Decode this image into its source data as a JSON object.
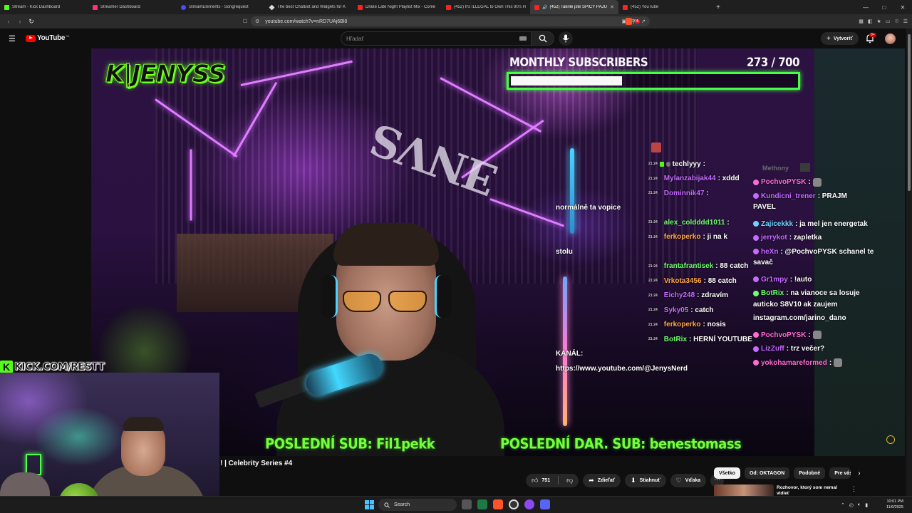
{
  "browser": {
    "tabs": [
      {
        "label": "Stream - Kick Dashboard",
        "color": "#53fc18"
      },
      {
        "label": "Streamer Dashboard",
        "color": "#ff2e7e"
      },
      {
        "label": "StreamElements - Songrequest",
        "color": "#4a4aff"
      },
      {
        "label": "The best ChatBot and Widgets for K",
        "color": "#dddddd"
      },
      {
        "label": "Drake Late Night Playlist Mix - Come",
        "color": "#ff2020"
      },
      {
        "label": "(452) It's ILLEGAL to Own This 90's H",
        "color": "#ff2020"
      },
      {
        "label": "(452) Takrile jste SPICY PÁJU",
        "color": "#ff2020",
        "active": true
      },
      {
        "label": "(452) YouTube",
        "color": "#ff2020"
      }
    ],
    "url": "youtube.com/watch?v=nRD7UAj6Bl8",
    "notif_count": "4"
  },
  "youtube": {
    "logo_text": "YouTube",
    "country_code": "SK",
    "search_placeholder": "Hľadať",
    "create_label": "Vytvoriť",
    "notification_badge": "9+"
  },
  "video": {
    "logo_overlay": "K|JENYSS",
    "subscribers_label": "MONTHLY SUBSCRIBERS",
    "subscribers_count": "273  / 700",
    "subscribers_current": 273,
    "subscribers_goal": 700,
    "last_sub": "POSLEDNÍ SUB: Fil1pekk",
    "last_gift_sub": "POSLEDNÍ DAR. SUB: benestomass",
    "kick_url": "KICK.COM/RESTT"
  },
  "stream_chat": [
    {
      "time": "21:24",
      "name": "techlyyy",
      "name_color": "#ffffff",
      "text": ":"
    },
    {
      "time": "21:24",
      "name": "Mylanzabijak44",
      "name_color": "#c56bff",
      "text": ": xddd"
    },
    {
      "time": "21:24",
      "name": "Dominnik47",
      "name_color": "#c56bff",
      "text": ": ",
      "cont": "normálně ta vopice"
    },
    {
      "time": "21:24",
      "name": "alex_coldddd1011",
      "name_color": "#6dff6d",
      "text": ": "
    },
    {
      "time": "21:24",
      "name": "ferkoperko",
      "name_color": "#ffa845",
      "text": ": ji na k",
      "cont": "stolu"
    },
    {
      "time": "21:24",
      "name": "frantafrantisek",
      "name_color": "#6dff6d",
      "text": ": 88 catch"
    },
    {
      "time": "21:24",
      "name": "Vrkota3456",
      "name_color": "#ffa845",
      "text": ": 88 catch"
    },
    {
      "time": "21:24",
      "name": "Eichy248",
      "name_color": "#c56bff",
      "text": ": zdravím"
    },
    {
      "time": "21:24",
      "name": "Syky05",
      "name_color": "#c56bff",
      "text": ": catch"
    },
    {
      "time": "21:24",
      "name": "ferkoperko",
      "name_color": "#ffa845",
      "text": ": nosis"
    },
    {
      "time": "21:24",
      "name": "BotRix",
      "name_color": "#6dff6d",
      "text": ": HERNÍ YOUTUBE",
      "cont": "KANÁL:",
      "cont2": "https://www.youtube.com/@JenysNerd"
    }
  ],
  "side_chat": {
    "ghost_name": "Methony",
    "messages": [
      {
        "name": "PochvoPYSK",
        "color": "#ff6bd5",
        "text": ":"
      },
      {
        "name": "Kundicni_trener",
        "color": "#c56bff",
        "text": ": PRAJM",
        "cont": "PAVEL"
      },
      {
        "name": "Zajicekkk",
        "color": "#6dd5ff",
        "text": ": ja mel jen energetak"
      },
      {
        "name": "jerrykot",
        "color": "#c56bff",
        "text": ": zapletka"
      },
      {
        "name": "heXn",
        "color": "#c56bff",
        "text": ": @PochvoPYSK schanel te",
        "cont": "savač"
      },
      {
        "name": "Gr1mpy",
        "color": "#c56bff",
        "text": ": !auto"
      },
      {
        "name": "BotRix",
        "color": "#6dff6d",
        "text": ": na vianoce sa losuje",
        "cont": "auticko S8V10 ak zaujem",
        "cont2": "instagram.com/jarino_dano"
      },
      {
        "name": "PochvoPYSK",
        "color": "#ff6bd5",
        "text": ":"
      },
      {
        "name": "LizZuff",
        "color": "#c56bff",
        "text": ": trz večer?"
      },
      {
        "name": "yokohamareformed",
        "color": "#ff6bd5",
        "text": ":"
      }
    ]
  },
  "page": {
    "video_title": "! | Celebrity Series #4",
    "like_count": "751",
    "share_label": "Zdieľať",
    "download_label": "Stiahnuť",
    "thanks_label": "Vďaka",
    "chips": [
      "Všetko",
      "Od: OKTAGON",
      "Podobné",
      "Pre vás"
    ],
    "rec_title": "Rozhovor, ktorý som nemal vidieť"
  },
  "taskbar": {
    "search_label": "Search",
    "time": "10:01 PM",
    "date": "11/6/2025"
  }
}
